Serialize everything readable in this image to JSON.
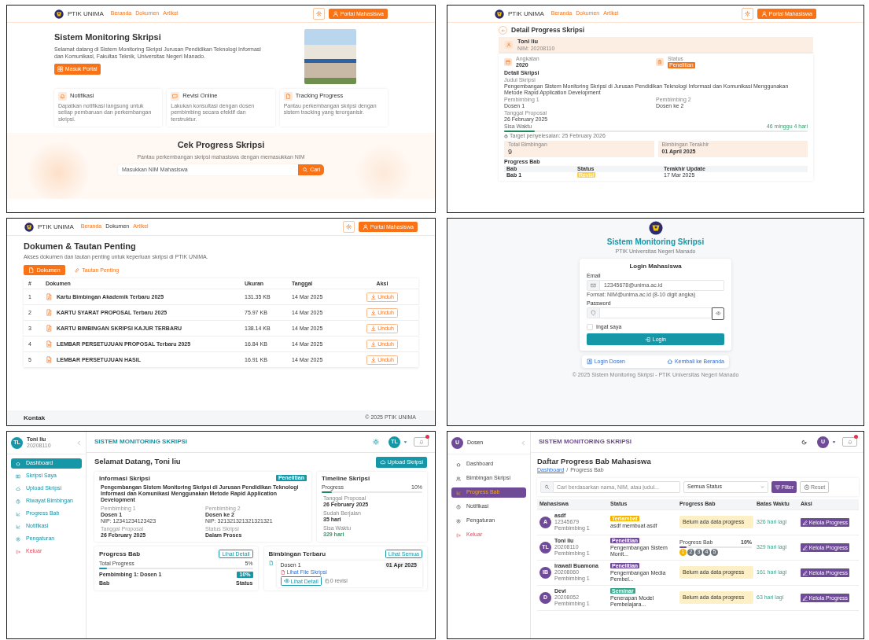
{
  "landing": {
    "nav": {
      "brand": "PTIK UNIMA",
      "links": [
        {
          "label": "Beranda",
          "selected": false
        },
        {
          "label": "Dokumen",
          "selected": false
        },
        {
          "label": "Artikel",
          "selected": false
        }
      ],
      "portal_button": "Portal Mahasiswa"
    },
    "hero": {
      "title": "Sistem Monitoring Skripsi",
      "text": "Selamat datang di Sistem Monitoring Skripsi Jurusan Pendidikan Teknologi Informasi dan Komunikasi, Fakultas Teknik, Universitas Negeri Manado.",
      "button": "Masuk Portal"
    },
    "features": [
      {
        "title": "Notifikasi",
        "text": "Dapatkan notifikasi langsung untuk setiap pembaruan dan perkembangan skripsi."
      },
      {
        "title": "Revisi Online",
        "text": "Lakukan konsultasi dengan dosen pembimbing secara efektif dan terstruktur."
      },
      {
        "title": "Tracking Progress",
        "text": "Pantau perkembangan skripsi dengan sistem tracking yang terorganisir."
      }
    ],
    "nim_check": {
      "title": "Cek Progress Skripsi",
      "subtitle": "Pantau perkembangan skripsi mahasiswa dengan memasukkan NIM",
      "placeholder": "Masukkan NIM Mahasiswa",
      "button": "Cari"
    }
  },
  "progress_detail": {
    "nav": {
      "brand": "PTIK UNIMA",
      "links": [
        {
          "label": "Beranda",
          "selected": false
        },
        {
          "label": "Dokumen",
          "selected": false
        },
        {
          "label": "Artikel",
          "selected": false
        }
      ],
      "portal_button": "Portal Mahasiswa"
    },
    "title": "Detail Progress Skripsi",
    "student": {
      "name": "Toni liu",
      "nim": "NIM: 20208110"
    },
    "facts": [
      {
        "label": "Angkatan",
        "value": "2020",
        "kind": "text"
      },
      {
        "label": "Status",
        "value": "Penelitian",
        "kind": "badge"
      }
    ],
    "section_title": "Detail Skripsi",
    "thesis": {
      "label": "Judul Skripsi",
      "value": "Pengembangan Sistem Monitoring Skripsi di Jurusan Pendidikan Teknologi Informasi dan Komunikasi Menggunakan Metode Rapid Application Development"
    },
    "supervisors": [
      {
        "label": "Pembimbing 1",
        "value": "Dosen 1"
      },
      {
        "label": "Pembimbing 2",
        "value": "Dosen ke 2"
      }
    ],
    "proposal_date": {
      "label": "Tanggal Proposal",
      "value": "26 February 2025"
    },
    "remaining": {
      "label": "Sisa Waktu",
      "reading": "46 minggu 4 hari",
      "level": 0.1,
      "target": "Target penyelesaian: 25 February 2026"
    },
    "stats": [
      {
        "label": "Total Bimbingan",
        "value": "9",
        "kind": "big"
      },
      {
        "label": "Bimbingan Terakhir",
        "value": "01 April 2025",
        "kind": "small"
      }
    ],
    "chapters_title": "Progress Bab",
    "chapter_table": {
      "columns": [
        "Bab",
        "Status",
        "Terakhir Update"
      ],
      "rows": [
        {
          "chapter": "Bab 1",
          "status": "Revisi",
          "updated": "17 Mar 2025"
        }
      ]
    }
  },
  "documents": {
    "nav": {
      "brand": "PTIK UNIMA",
      "links": [
        {
          "label": "Beranda",
          "selected": false
        },
        {
          "label": "Dokumen",
          "selected": true
        },
        {
          "label": "Artikel",
          "selected": false
        }
      ],
      "portal_button": "Portal Mahasiswa"
    },
    "title": "Dokumen & Tautan Penting",
    "description": "Akses dokumen dan tautan penting untuk keperluan skripsi di PTIK UNIMA.",
    "tabs": [
      {
        "label": "Dokumen",
        "selected": true
      },
      {
        "label": "Tautan Penting",
        "selected": false
      }
    ],
    "table": {
      "columns": [
        "#",
        "Dokumen",
        "Ukuran",
        "Tanggal",
        "Aksi"
      ],
      "rows": [
        {
          "no": "1",
          "kind": "pdf",
          "name": "Kartu Bimbingan Akademik Terbaru 2025",
          "size": "131.35 KB",
          "date": "14 Mar 2025",
          "action": "Unduh"
        },
        {
          "no": "2",
          "kind": "pdf",
          "name": "KARTU SYARAT PROPOSAL Terbaru 2025",
          "size": "75.97 KB",
          "date": "14 Mar 2025",
          "action": "Unduh"
        },
        {
          "no": "3",
          "kind": "pdf",
          "name": "KARTU BIMBINGAN SKRIPSI KAJUR TERBARU",
          "size": "138.14 KB",
          "date": "14 Mar 2025",
          "action": "Unduh"
        },
        {
          "no": "4",
          "kind": "word",
          "name": "LEMBAR PERSETUJUAN PROPOSAL Terbaru 2025",
          "size": "16.84 KB",
          "date": "14 Mar 2025",
          "action": "Unduh"
        },
        {
          "no": "5",
          "kind": "word",
          "name": "LEMBAR PERSETUJUAN HASIL",
          "size": "16.91 KB",
          "date": "14 Mar 2025",
          "action": "Unduh"
        }
      ]
    },
    "footer": {
      "title": "Kontak",
      "copyright": "© 2025 PTIK UNIMA"
    }
  },
  "login": {
    "title": "Sistem Monitoring Skripsi",
    "subtitle": "PTIK Universitas Negeri Manado",
    "card_title": "Login Mahasiswa",
    "email": {
      "label": "Email",
      "placeholder": "12345678@unima.ac.id",
      "hint": "Format: NIM@unima.ac.id (8-10 digit angka)"
    },
    "password": {
      "label": "Password"
    },
    "remember": {
      "label": "Ingat saya",
      "checked": false
    },
    "button": "Login",
    "links": [
      "Login Dosen",
      "Kembali ke Beranda"
    ],
    "footer": "© 2025 Sistem Monitoring Skripsi - PTIK Universitas Negeri Manado"
  },
  "student_dashboard": {
    "user": {
      "initials": "TL",
      "name": "Toni liu",
      "nim": "20208110"
    },
    "menu": [
      {
        "label": "Dashboard",
        "selected": true,
        "kind": "link"
      },
      {
        "label": "Skripsi Saya",
        "selected": false,
        "kind": "link"
      },
      {
        "label": "Upload Skripsi",
        "selected": false,
        "kind": "link"
      },
      {
        "label": "Riwayat Bimbingan",
        "selected": false,
        "kind": "link"
      },
      {
        "label": "Progress Bab",
        "selected": false,
        "kind": "link"
      },
      {
        "label": "Notifikasi",
        "selected": false,
        "kind": "link"
      },
      {
        "label": "Pengaturan",
        "selected": false,
        "kind": "link"
      },
      {
        "label": "Keluar",
        "selected": false,
        "kind": "danger"
      }
    ],
    "app_title": "SISTEM MONITORING SKRIPSI",
    "avatar": "TL",
    "welcome": "Selamat Datang, Toni liu",
    "upload_button": "Upload Skripsi",
    "info": {
      "title": "Informasi Skripsi",
      "badge": "Penelitian",
      "thesis_title": "Pengembangan Sistem Monitoring Skripsi di Jurusan Pendidikan Teknologi Informasi dan Komunikasi Menggunakan Metode Rapid Application Development",
      "fields": [
        {
          "label": "Pembimbing 1",
          "value": "Dosen 1",
          "note": "NIP: 12341234123423"
        },
        {
          "label": "Pembimbing 2",
          "value": "Dosen ke 2",
          "note": "NIP: 321321321321321321"
        },
        {
          "label": "Tanggal Proposal",
          "value": "26 February 2025"
        },
        {
          "label": "Status Skripsi",
          "value": "Dalam Proses"
        }
      ]
    },
    "timeline": {
      "title": "Timeline Skripsi",
      "progress_label": "Progress",
      "progress_reading": "10%",
      "level": 0.1,
      "items": [
        {
          "label": "Tanggal Proposal",
          "value": "26 February 2025",
          "kind": "plain"
        },
        {
          "label": "Sudah Berjalan",
          "value": "35 hari",
          "kind": "plain"
        },
        {
          "label": "Sisa Waktu",
          "value": "329 hari",
          "kind": "good"
        }
      ]
    },
    "progress": {
      "title": "Progress Bab",
      "button": "Lihat Detail",
      "total_label": "Total Progress",
      "total_reading": "5%",
      "level": 0.05,
      "supervisor": "Pembimbing 1: Dosen 1",
      "supervisor_badge": "10%",
      "columns": [
        "Bab",
        "Status"
      ]
    },
    "guidance": {
      "title": "Bimbingan Terbaru",
      "button": "Lihat Semua",
      "entries": [
        {
          "lecturer": "Dosen 1",
          "date": "01 Apr 2025",
          "file_link": "Lihat File Skripsi",
          "detail_button": "Lihat Detail",
          "revisions": "0 revisi"
        }
      ]
    }
  },
  "lecturer_progress": {
    "user": {
      "initials": "U",
      "name": "Dosen"
    },
    "menu": [
      {
        "label": "Dashboard",
        "selected": false,
        "kind": "link"
      },
      {
        "label": "Bimbingan Skripsi",
        "selected": false,
        "kind": "link"
      },
      {
        "label": "Progress Bab",
        "selected": true,
        "kind": "link"
      },
      {
        "label": "Notifikasi",
        "selected": false,
        "kind": "link"
      },
      {
        "label": "Pengaturan",
        "selected": false,
        "kind": "link"
      },
      {
        "label": "Keluar",
        "selected": false,
        "kind": "danger"
      }
    ],
    "app_title": "SISTEM MONITORING SKRIPSI",
    "avatar": "U",
    "title": "Daftar Progress Bab Mahasiswa",
    "breadcrumb": [
      {
        "label": "Dashboard",
        "kind": "link"
      },
      {
        "label": "Progress Bab",
        "kind": "current"
      }
    ],
    "breadcrumb_separator": "/",
    "search": {
      "placeholder": "Cari berdasarkan nama, NIM, atau judul..."
    },
    "status_select": "Semua Status",
    "filter_button": "Filter",
    "reset_button": "Reset",
    "table": {
      "columns": [
        "Mahasiswa",
        "Status",
        "Progress Bab",
        "Batas Waktu",
        "Aksi"
      ],
      "rows": [
        {
          "initials": "A",
          "name": "asdf",
          "nim": "12345679",
          "role": "Pembimbing 1",
          "status": "Terlambat",
          "color": "#f5b400",
          "thesis": "asdf membuat asdf",
          "progress": {
            "kind": "empty",
            "text": "Belum ada data progress"
          },
          "deadline": "326 hari lagi",
          "action": "Kelola Progress"
        },
        {
          "initials": "TL",
          "name": "Toni liu",
          "nim": "20208110",
          "role": "Pembimbing 1",
          "status": "Penelitian",
          "color": "#6f4a97",
          "thesis": "Pengembangan Sistem Monit...",
          "progress": {
            "kind": "bar",
            "label": "Progress Bab",
            "reading": "10%",
            "level": 0.1,
            "chapters": [
              {
                "label": "1",
                "color": "#f5b400"
              },
              {
                "label": "2",
                "color": "#6c757d"
              },
              {
                "label": "3",
                "color": "#6c757d"
              },
              {
                "label": "4",
                "color": "#6c757d"
              },
              {
                "label": "5",
                "color": "#6c757d"
              }
            ]
          },
          "deadline": "329 hari lagi",
          "action": "Kelola Progress"
        },
        {
          "initials": "IB",
          "name": "Irawati Buamona",
          "nim": "20208060",
          "role": "Pembimbing 1",
          "status": "Penelitian",
          "color": "#6f4a97",
          "thesis": "Pengembangan Media Pembel...",
          "progress": {
            "kind": "empty",
            "text": "Belum ada data progress"
          },
          "deadline": "161 hari lagi",
          "action": "Kelola Progress"
        },
        {
          "initials": "D",
          "name": "Devi",
          "nim": "20208052",
          "role": "Pembimbing 1",
          "status": "Seminar",
          "color": "#3aa58a",
          "thesis": "Penerapan Model Pembelajara...",
          "progress": {
            "kind": "empty",
            "text": "Belum ada data progress"
          },
          "deadline": "63 hari lagi",
          "action": "Kelola Progress"
        }
      ]
    }
  }
}
